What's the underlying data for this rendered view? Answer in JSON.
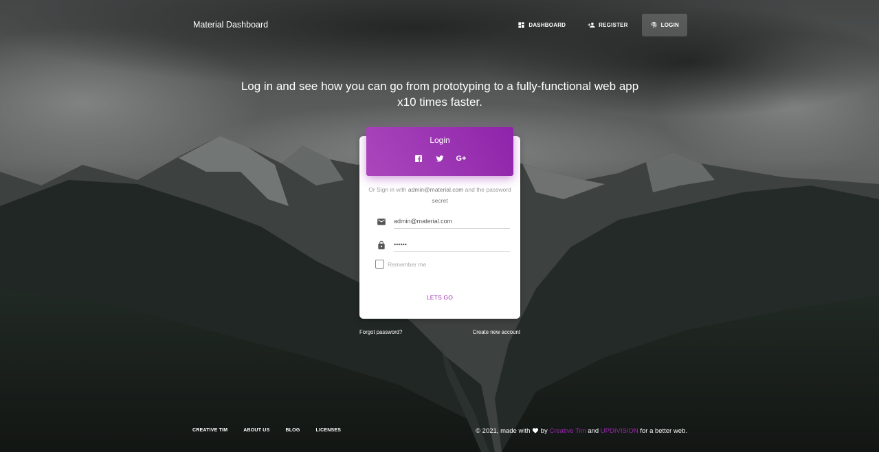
{
  "colors": {
    "primary": "#9c27b0",
    "header_gradient_start": "#ab47bc",
    "header_gradient_end": "#8e24aa"
  },
  "navbar": {
    "brand": "Material Dashboard",
    "items": [
      {
        "label": "DASHBOARD",
        "icon": "dashboard-icon",
        "active": false
      },
      {
        "label": "REGISTER",
        "icon": "person-add-icon",
        "active": false
      },
      {
        "label": "LOGIN",
        "icon": "fingerprint-icon",
        "active": true
      }
    ]
  },
  "hero": {
    "tagline": "Log in and see how you can go from prototyping to a fully-functional web app x10 times faster."
  },
  "login_card": {
    "title": "Login",
    "socials": [
      "facebook-icon",
      "twitter-icon",
      "google-plus-icon"
    ],
    "description_prefix": "Or Sign in with ",
    "description_email": "admin@material.com",
    "description_middle": " and the password ",
    "description_password": "secret",
    "email_value": "admin@material.com",
    "password_value": "secret",
    "remember_label": "Remember me",
    "submit_label": "LETS GO"
  },
  "links": {
    "forgot": "Forgot password?",
    "create": "Create new account"
  },
  "footer": {
    "links": [
      "CREATIVE TIM",
      "ABOUT US",
      "BLOG",
      "LICENSES"
    ],
    "copyright_prefix": "© 2021, made with ",
    "copyright_by": " by ",
    "creative_tim": "Creative Tim",
    "and": " and ",
    "updivision": "UPDIVISION",
    "suffix": " for a better web."
  }
}
